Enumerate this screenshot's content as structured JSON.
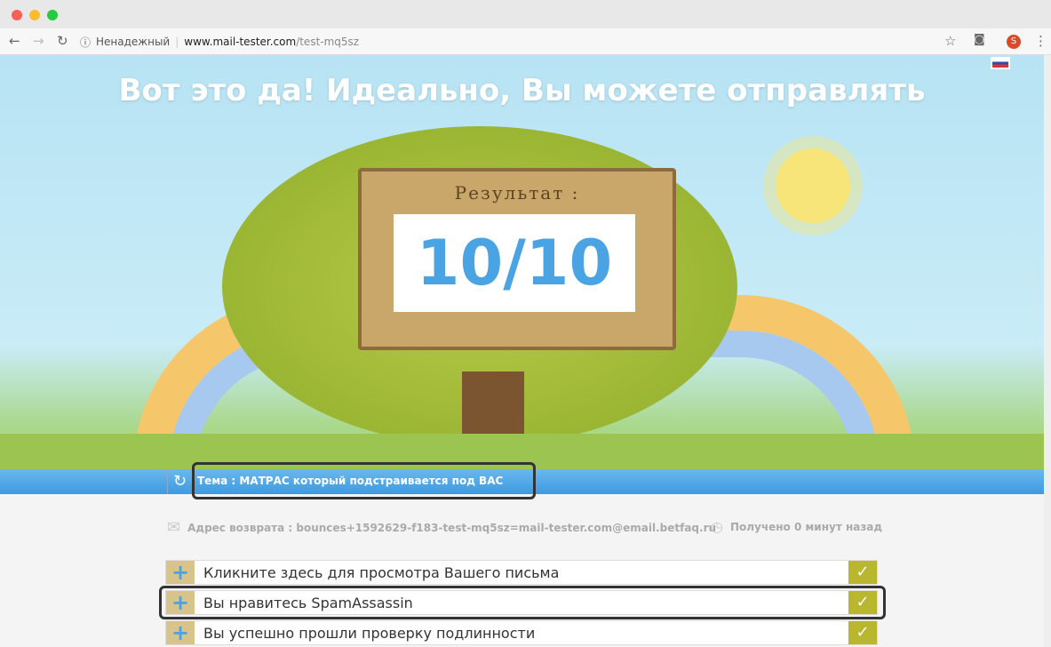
{
  "browser": {
    "security": "Ненадежный",
    "url_host": "www.mail-tester.com",
    "url_path": "/test-mq5sz",
    "profile": "S"
  },
  "hero": {
    "title": "Вот это да! Идеально, Вы можете отправлять",
    "sign_label": "Результат :",
    "score": "10/10"
  },
  "subject": {
    "label": "Тема : МАТРАС который подстраивается под ВАС"
  },
  "meta": {
    "return_path": "Адрес возврата : bounces+1592629-f183-test-mq5sz=mail-tester.com@email.betfaq.ru",
    "received": "Получено 0 минут назад"
  },
  "results": [
    {
      "label": "Кликните здесь для просмотра Вашего письма"
    },
    {
      "label": "Вы нравитесь SpamAssassin"
    },
    {
      "label": "Вы успешно прошли проверку подлинности"
    }
  ]
}
